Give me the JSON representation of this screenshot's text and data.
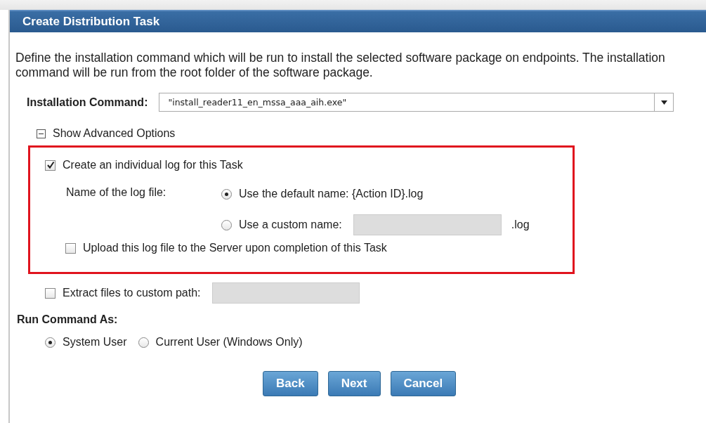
{
  "window": {
    "title": "Create Distribution Task"
  },
  "description": "Define the installation command which will be run to install the selected software package on endpoints. The installation command will be run from the root folder of the software package.",
  "installation_command": {
    "label": "Installation Command:",
    "value": "\"install_reader11_en_mssa_aaa_aih.exe\""
  },
  "advanced": {
    "label": "Show Advanced Options",
    "expanded": true
  },
  "individual_log": {
    "label": "Create an individual log for this Task",
    "checked": true
  },
  "log_name": {
    "label": "Name of the log file:",
    "options": [
      {
        "label": "Use the default name: {Action ID}.log",
        "selected": true
      },
      {
        "label": "Use a custom name:",
        "selected": false,
        "suffix": ".log"
      }
    ]
  },
  "upload_log": {
    "label": "Upload this log file to the Server upon completion of this Task",
    "checked": false
  },
  "extract": {
    "label": "Extract files to custom path:",
    "checked": false
  },
  "run_as": {
    "label": "Run Command As:",
    "options": [
      {
        "label": "System User",
        "selected": true
      },
      {
        "label": "Current User (Windows Only)",
        "selected": false
      }
    ]
  },
  "buttons": [
    "Back",
    "Next",
    "Cancel"
  ]
}
